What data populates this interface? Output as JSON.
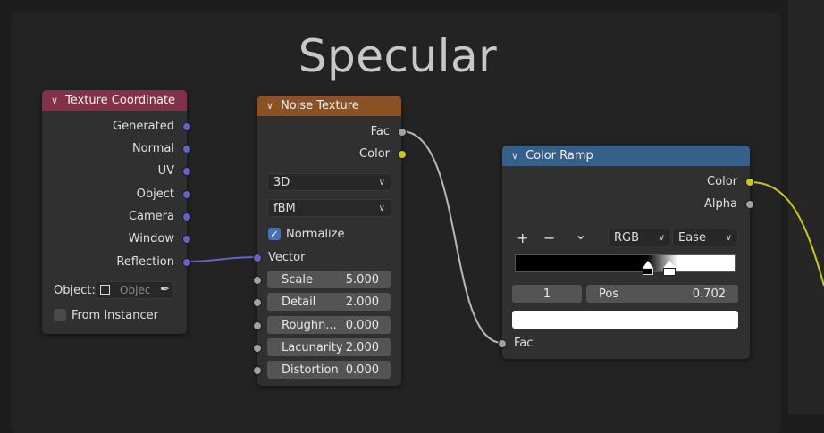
{
  "frame": {
    "title": "Specular"
  },
  "texture_coordinate": {
    "title": "Texture Coordinate",
    "outputs": [
      "Generated",
      "Normal",
      "UV",
      "Object",
      "Camera",
      "Window",
      "Reflection"
    ],
    "object_label": "Object:",
    "object_placeholder": "Objec",
    "from_instancer": "From Instancer"
  },
  "noise_texture": {
    "title": "Noise Texture",
    "outputs": [
      "Fac",
      "Color"
    ],
    "dimensions": "3D",
    "type": "fBM",
    "normalize": "Normalize",
    "vector": "Vector",
    "inputs": [
      {
        "label": "Scale",
        "value": "5.000"
      },
      {
        "label": "Detail",
        "value": "2.000"
      },
      {
        "label": "Roughn...",
        "value": "0.000"
      },
      {
        "label": "Lacunarity",
        "value": "2.000"
      },
      {
        "label": "Distortion",
        "value": "0.000"
      }
    ]
  },
  "color_ramp": {
    "title": "Color Ramp",
    "outputs": [
      "Color",
      "Alpha"
    ],
    "add": "+",
    "remove": "−",
    "menu": "⌄",
    "color_mode": "RGB",
    "interpolation": "Ease",
    "index": "1",
    "pos_label": "Pos",
    "pos_value": "0.702",
    "input": "Fac"
  },
  "colors": {
    "texture_header": "#83314a",
    "noise_header": "#8a5221",
    "ramp_header": "#356089",
    "socket_vector": "#6363c7",
    "socket_float": "#a1a1a1",
    "socket_color": "#c7c729"
  }
}
